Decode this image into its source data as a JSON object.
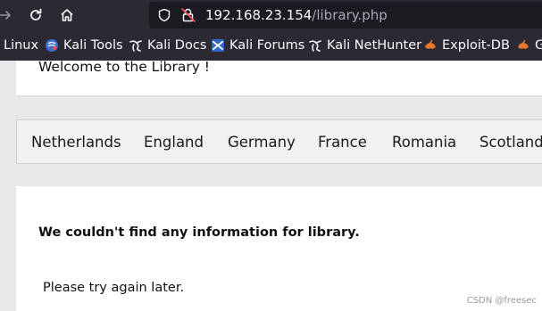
{
  "browser": {
    "url_host": "192.168.23.154",
    "url_path": "/library.php"
  },
  "bookmarks": [
    {
      "label": "Linux",
      "icon": "none"
    },
    {
      "label": "Kali Tools",
      "icon": "kali-tools-icon"
    },
    {
      "label": "Kali Docs",
      "icon": "kali-dragon-icon"
    },
    {
      "label": "Kali Forums",
      "icon": "kali-forums-icon"
    },
    {
      "label": "Kali NetHunter",
      "icon": "kali-dragon-icon"
    },
    {
      "label": "Exploit-DB",
      "icon": "exploit-db-icon"
    },
    {
      "label": "G",
      "icon": "exploit-db-icon"
    }
  ],
  "page": {
    "welcome": "Welcome to the Library !",
    "countries": [
      "Netherlands",
      "England",
      "Germany",
      "France",
      "Romania",
      "Scotland"
    ],
    "error_title": "We couldn't find any information for library.",
    "error_message": "Please try again later."
  },
  "watermark": "CSDN @freesec",
  "colors": {
    "chrome_bg": "#2b2a33",
    "urlbar_bg": "#1c1b22",
    "page_bg": "#e9e9ec",
    "exploit_db_orange": "#e8752b"
  }
}
